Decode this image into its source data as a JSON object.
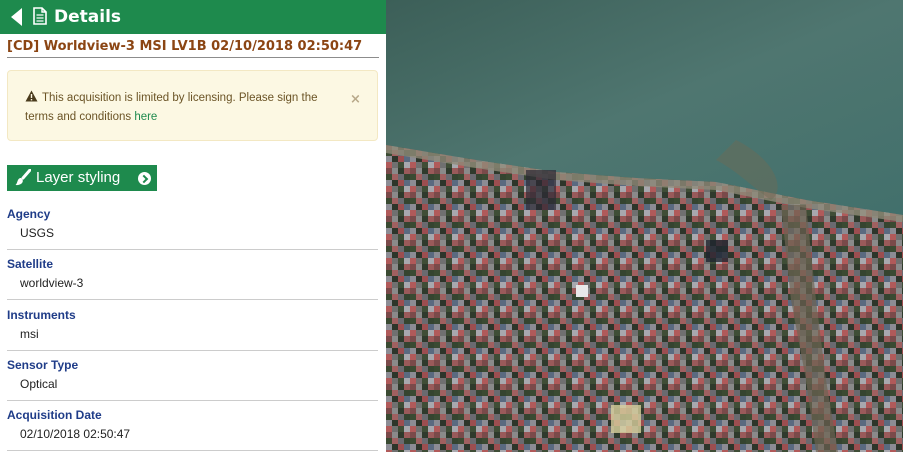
{
  "header": {
    "title": "Details"
  },
  "product": {
    "title": "[CD] Worldview-3 MSI LV1B 02/10/2018 02:50:47"
  },
  "alert": {
    "text": "This acquisition is limited by licensing. Please sign the terms and conditions ",
    "link_text": "here",
    "close_symbol": "×"
  },
  "layer_styling": {
    "label": "Layer styling"
  },
  "fields": [
    {
      "label": "Agency",
      "value": "USGS"
    },
    {
      "label": "Satellite",
      "value": "worldview-3"
    },
    {
      "label": "Instruments",
      "value": "msi"
    },
    {
      "label": "Sensor Type",
      "value": "Optical"
    },
    {
      "label": "Acquisition Date",
      "value": "02/10/2018 02:50:47"
    }
  ],
  "colors": {
    "accent": "#1e8a4d",
    "title": "#8b4513",
    "label": "#1f3c88",
    "alert_bg": "#fcf8e3"
  }
}
